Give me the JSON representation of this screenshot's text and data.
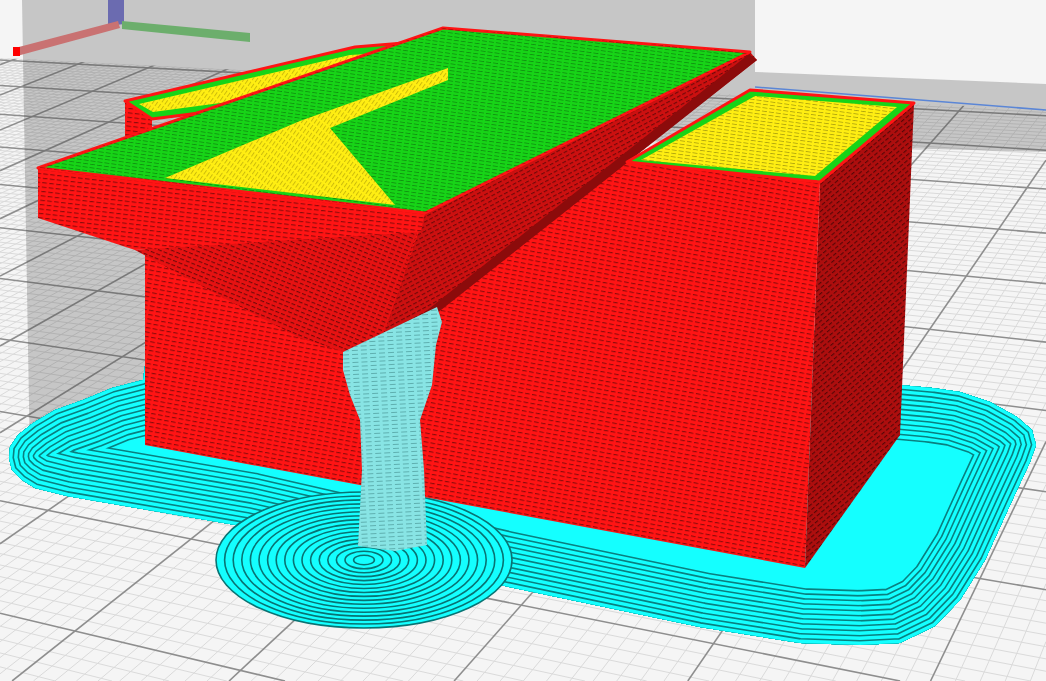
{
  "layer_view": {
    "line_types": [
      {
        "kind": "outer_wall",
        "color": "#ff1414"
      },
      {
        "kind": "inner_wall",
        "color": "#17d417"
      },
      {
        "kind": "skin",
        "color": "#ffee12"
      },
      {
        "kind": "adhesion",
        "color": "#14ffff"
      },
      {
        "kind": "support",
        "color": "#88e4e4"
      }
    ]
  }
}
